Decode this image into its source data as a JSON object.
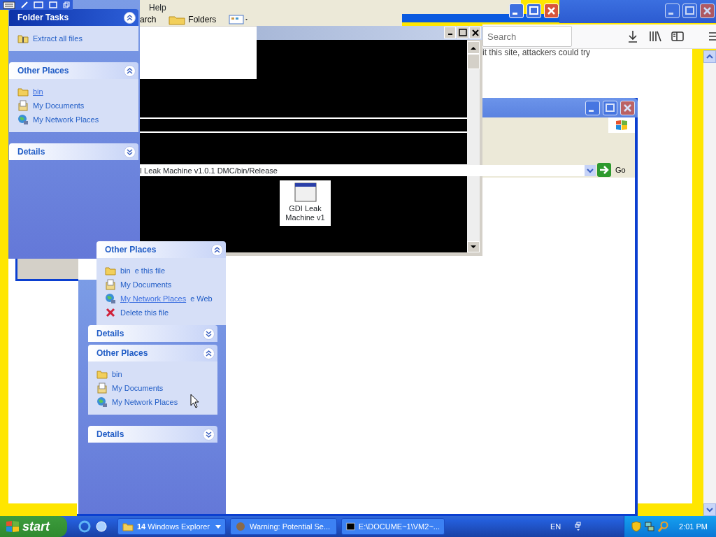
{
  "browser": {
    "search": {
      "placeholder": "Search"
    },
    "page_text": "it this site, attackers could try"
  },
  "explorer_top": {
    "menu": "Help",
    "buttons": [
      {
        "label": "arch",
        "kind": "search"
      },
      {
        "label": "Folders",
        "kind": "folders"
      }
    ]
  },
  "task_pane_top": {
    "sections": [
      {
        "title": "Folder Tasks",
        "kind": "special",
        "expanded": true,
        "items": [
          {
            "label": "Extract all files",
            "kind": "zip",
            "hovered": false
          }
        ]
      },
      {
        "title": "Other Places",
        "kind": "normal",
        "expanded": true,
        "items": [
          {
            "label": "bin",
            "kind": "folder",
            "hovered": true
          },
          {
            "label": "My Documents",
            "kind": "documents",
            "hovered": false
          },
          {
            "label": "My Network Places",
            "kind": "network",
            "hovered": false
          }
        ]
      },
      {
        "title": "Details",
        "kind": "normal",
        "expanded": false
      }
    ]
  },
  "console": {
    "file": {
      "label": "GDI Leak Machine v1"
    }
  },
  "explorer_window": {
    "address": {
      "value": "I Leak Machine v1.0.1 DMC/bin/Release",
      "go_label": "Go"
    },
    "task_pane": {
      "sections": [
        {
          "title": "Other Places",
          "kind": "normal",
          "expanded": true,
          "items": [
            {
              "label": "bin",
              "overlap_text": "e this file",
              "kind": "folder",
              "hovered": false
            },
            {
              "label": "My Documents",
              "kind": "documents",
              "hovered": false
            },
            {
              "label": "My Network Places",
              "overlap_text": "e Web",
              "kind": "network",
              "hovered": true
            },
            {
              "label": "Delete this file",
              "kind": "delete",
              "hovered": false
            }
          ]
        },
        {
          "title": "Details",
          "kind": "normal",
          "expanded": false
        },
        {
          "title": "Other Places",
          "kind": "normal",
          "expanded": true,
          "items": [
            {
              "label": "bin",
              "kind": "folder",
              "hovered": false
            },
            {
              "label": "My Documents",
              "kind": "documents",
              "hovered": false
            },
            {
              "label": "My Network Places",
              "kind": "network",
              "hovered": false
            }
          ]
        },
        {
          "title": "Details",
          "kind": "normal",
          "expanded": false
        }
      ]
    }
  },
  "taskbar": {
    "start": "start",
    "buttons": [
      {
        "label": "**14** Windows Explorer",
        "kind": "explorer",
        "group": true,
        "selected": false
      },
      {
        "label": "Warning: Potential Se...",
        "kind": "browser",
        "group": false,
        "selected": false
      },
      {
        "label": "E:\\DOCUME~1\\VM2~...",
        "kind": "console",
        "group": false,
        "selected": false
      }
    ],
    "language": "EN",
    "clock": "2:01 PM"
  }
}
